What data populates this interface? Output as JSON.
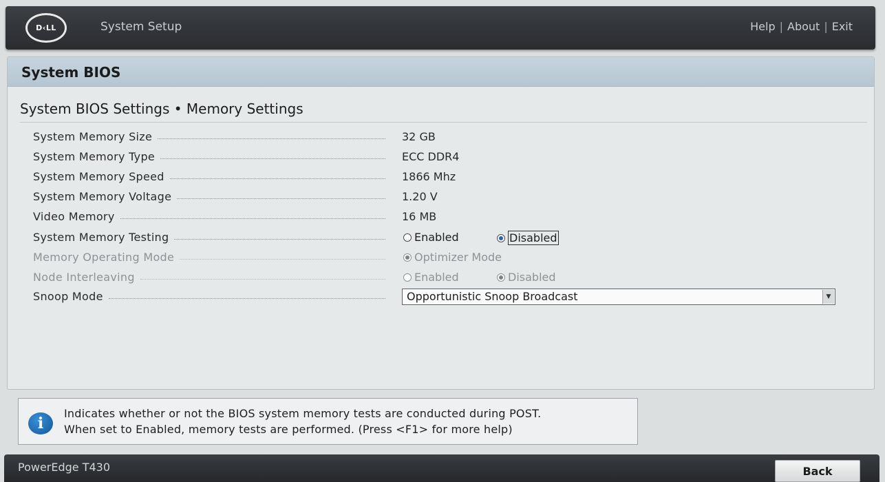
{
  "header": {
    "logo_text": "D‹LL",
    "app_title": "System Setup",
    "links": [
      "Help",
      "About",
      "Exit"
    ],
    "separator": "|"
  },
  "panel": {
    "title": "System BIOS",
    "breadcrumb": "System BIOS Settings • Memory Settings"
  },
  "settings": [
    {
      "label": "System Memory Size",
      "value": "32 GB"
    },
    {
      "label": "System Memory Type",
      "value": "ECC DDR4"
    },
    {
      "label": "System Memory Speed",
      "value": "1866 Mhz"
    },
    {
      "label": "System Memory Voltage",
      "value": "1.20 V"
    },
    {
      "label": "Video Memory",
      "value": "16 MB"
    },
    {
      "label": "System Memory Testing",
      "options": [
        "Enabled",
        "Disabled"
      ],
      "selected": "Disabled"
    },
    {
      "label": "Memory Operating Mode",
      "options": [
        "Optimizer Mode"
      ],
      "selected": "Optimizer Mode",
      "disabled": true
    },
    {
      "label": "Node Interleaving",
      "options": [
        "Enabled",
        "Disabled"
      ],
      "selected": "Disabled",
      "disabled": true
    },
    {
      "label": "Snoop Mode",
      "select_value": "Opportunistic Snoop Broadcast"
    }
  ],
  "help": {
    "icon": "info-icon",
    "line1": "Indicates whether or not the BIOS system memory tests are conducted during POST.",
    "line2": "When set to Enabled, memory tests are performed. (Press <F1> for more help)"
  },
  "footer": {
    "model": "PowerEdge T430",
    "back_label": "Back"
  }
}
